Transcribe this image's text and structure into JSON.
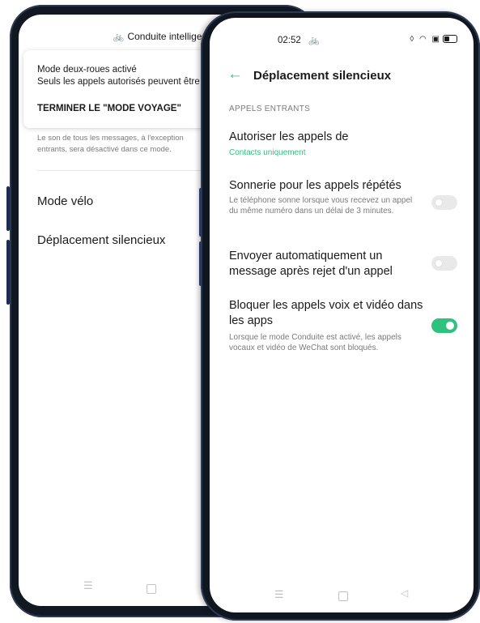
{
  "back_phone": {
    "title": "Conduite intelligente",
    "title_icon": "bicycle-icon",
    "card": {
      "line1": "Mode deux-roues activé",
      "line2": "Seuls les appels autorisés peuvent être",
      "action": "TERMINER LE \"MODE VOYAGE\""
    },
    "description": "Le son de tous les messages, à l'exception entrants, sera désactivé dans ce mode.",
    "items": [
      "Mode vélo",
      "Déplacement silencieux"
    ],
    "nav": {
      "menu_glyph": "☰",
      "home_icon": "square-icon"
    }
  },
  "front_phone": {
    "status_bar": {
      "time": "02:52",
      "bike_glyph": "🚲",
      "icons_glyph": "◊ ◠ ▣"
    },
    "header": {
      "back_glyph": "←",
      "title": "Déplacement silencieux"
    },
    "section": "APPELS ENTRANTS",
    "settings": [
      {
        "title": "Autoriser les appels de",
        "subtitle": "Contacts uniquement"
      },
      {
        "title": "Sonnerie pour les appels répétés",
        "subtitle": "Le téléphone sonne lorsque vous recevez un appel du même numéro dans un délai de 3 minutes.",
        "enabled": false
      },
      {
        "title": "Envoyer automatiquement un message après rejet d'un appel",
        "subtitle": "",
        "enabled": false
      },
      {
        "title": "Bloquer les appels voix et vidéo dans les apps",
        "subtitle": "Lorsque le mode Conduite est activé, les appels vocaux et vidéo de WeChat sont bloqués.",
        "enabled": true
      }
    ],
    "nav": {
      "menu_glyph": "☰",
      "back_glyph": "◁"
    },
    "accent_color": "#2ec27e"
  }
}
